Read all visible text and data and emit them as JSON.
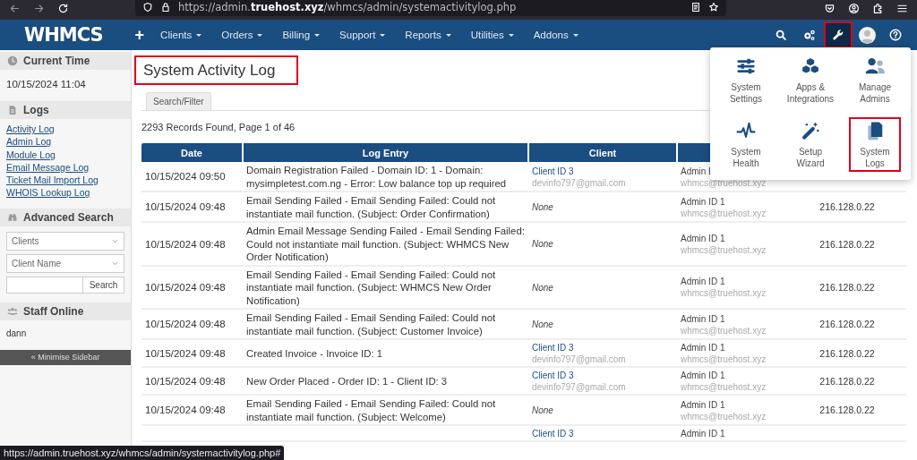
{
  "browser": {
    "url": "https://admin.**truehost.xyz**/whmcs/admin/systemactivitylog.php"
  },
  "nav": {
    "logo": "WHMCS",
    "add": "+",
    "menus": [
      {
        "label": "Clients"
      },
      {
        "label": "Orders"
      },
      {
        "label": "Billing"
      },
      {
        "label": "Support"
      },
      {
        "label": "Reports"
      },
      {
        "label": "Utilities"
      },
      {
        "label": "Addons"
      }
    ],
    "tools": [
      {
        "kind": "search",
        "active": false,
        "highlighted": false
      },
      {
        "kind": "gears",
        "active": false,
        "highlighted": false
      },
      {
        "kind": "wrench",
        "active": true,
        "highlighted": true
      },
      {
        "kind": "avatar",
        "active": false,
        "highlighted": false
      },
      {
        "kind": "help",
        "active": false,
        "highlighted": false
      }
    ]
  },
  "sidebar": {
    "panels": [
      {
        "kind": "time",
        "title": "Current Time",
        "value": "10/15/2024 11:04"
      },
      {
        "kind": "links",
        "title": "Logs",
        "links": [
          "Activity Log",
          "Admin Log",
          "Module Log",
          "Email Message Log",
          "Ticket Mail Import Log",
          "WHOIS Lookup Log"
        ]
      },
      {
        "kind": "search",
        "title": "Advanced Search",
        "selects": [
          "Clients",
          "Client Name"
        ],
        "button": "Search"
      },
      {
        "kind": "staff",
        "title": "Staff Online",
        "names": [
          "dann"
        ]
      }
    ],
    "minimise": "« Minimise Sidebar"
  },
  "page": {
    "title": "System Activity Log",
    "title_highlighted": true,
    "tabs": [
      {
        "label": "Search/Filter",
        "selected": false
      }
    ],
    "summary": "2293 Records Found, Page 1 of 46"
  },
  "table": {
    "columns": [
      "Date",
      "Log Entry",
      "Client"
    ],
    "rows": [
      {
        "date": "10/15/2024 09:50",
        "entry": "Domain Registration Failed - Domain ID: 1 - Domain: mysimpletest.com.ng - Error: Low balance top up required",
        "client": {
          "kind": "client",
          "name": "Client ID 3",
          "email": "devinfo797@gmail.com"
        },
        "admin": {
          "name": "Admin I",
          "email": "whmcs@truehost.xyz"
        }
      },
      {
        "date": "10/15/2024 09:48",
        "entry": "Email Sending Failed - Email Sending Failed: Could not instantiate mail function. (Subject: Order Confirmation)",
        "client": {
          "kind": "none",
          "name": "None"
        },
        "admin": {
          "name": "Admin ID 1",
          "email": "whmcs@truehost.xyz"
        },
        "ip": "216.128.0.22"
      },
      {
        "date": "10/15/2024 09:48",
        "entry": "Admin Email Message Sending Failed - Email Sending Failed: Could not instantiate mail function. (Subject: WHMCS New Order Notification)",
        "client": {
          "kind": "none",
          "name": "None"
        },
        "admin": {
          "name": "Admin ID 1",
          "email": "whmcs@truehost.xyz"
        },
        "ip": "216.128.0.22"
      },
      {
        "date": "10/15/2024 09:48",
        "entry": "Email Sending Failed - Email Sending Failed: Could not instantiate mail function. (Subject: WHMCS New Order Notification)",
        "client": {
          "kind": "none",
          "name": "None"
        },
        "admin": {
          "name": "Admin ID 1",
          "email": "whmcs@truehost.xyz"
        },
        "ip": "216.128.0.22"
      },
      {
        "date": "10/15/2024 09:48",
        "entry": "Email Sending Failed - Email Sending Failed: Could not instantiate mail function. (Subject: Customer Invoice)",
        "client": {
          "kind": "none",
          "name": "None"
        },
        "admin": {
          "name": "Admin ID 1",
          "email": "whmcs@truehost.xyz"
        },
        "ip": "216.128.0.22"
      },
      {
        "date": "10/15/2024 09:48",
        "entry": "Created Invoice - Invoice ID: 1",
        "client": {
          "kind": "client",
          "name": "Client ID 3",
          "email": "devinfo797@gmail.com"
        },
        "admin": {
          "name": "Admin ID 1",
          "email": "whmcs@truehost.xyz"
        },
        "ip": "216.128.0.22"
      },
      {
        "date": "10/15/2024 09:48",
        "entry": "New Order Placed - Order ID: 1 - Client ID: 3",
        "client": {
          "kind": "client",
          "name": "Client ID 3",
          "email": "devinfo797@gmail.com"
        },
        "admin": {
          "name": "Admin ID 1",
          "email": "whmcs@truehost.xyz"
        },
        "ip": "216.128.0.22"
      },
      {
        "date": "10/15/2024 09:48",
        "entry": "Email Sending Failed - Email Sending Failed: Could not instantiate mail function. (Subject: Welcome)",
        "client": {
          "kind": "none",
          "name": "None"
        },
        "admin": {
          "name": "Admin ID 1",
          "email": "whmcs@truehost.xyz"
        },
        "ip": "216.128.0.22"
      },
      {
        "client": {
          "kind": "client",
          "name": "Client ID 3"
        },
        "admin": {
          "name": "Admin ID 1"
        }
      }
    ]
  },
  "menu": {
    "items": [
      {
        "kind": "settings",
        "label": "System Settings",
        "highlighted": false
      },
      {
        "kind": "apps",
        "label": "Apps & Integrations",
        "highlighted": false
      },
      {
        "kind": "admins",
        "label": "Manage Admins",
        "highlighted": false
      },
      {
        "kind": "health",
        "label": "System Health",
        "highlighted": false
      },
      {
        "kind": "wizard",
        "label": "Setup Wizard",
        "highlighted": false
      },
      {
        "kind": "logs",
        "label": "System Logs",
        "highlighted": true
      }
    ]
  },
  "status_url": "https://admin.truehost.xyz/whmcs/admin/systemactivitylog.php#"
}
